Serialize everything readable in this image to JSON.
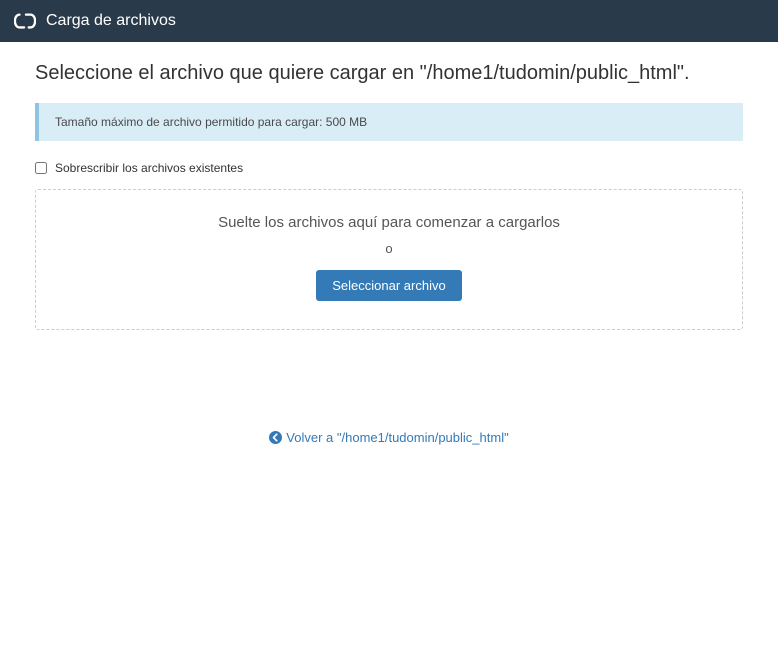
{
  "header": {
    "title": "Carga de archivos"
  },
  "main": {
    "page_title": "Seleccione el archivo que quiere cargar en \"/home1/tudomin/public_html\".",
    "info_message": "Tamaño máximo de archivo permitido para cargar: 500 MB",
    "overwrite_label": "Sobrescribir los archivos existentes",
    "dropzone_text": "Suelte los archivos aquí para comenzar a cargarlos",
    "dropzone_or": "o",
    "select_button_label": "Seleccionar archivo"
  },
  "footer": {
    "return_link_text": "Volver a \"/home1/tudomin/public_html\""
  }
}
